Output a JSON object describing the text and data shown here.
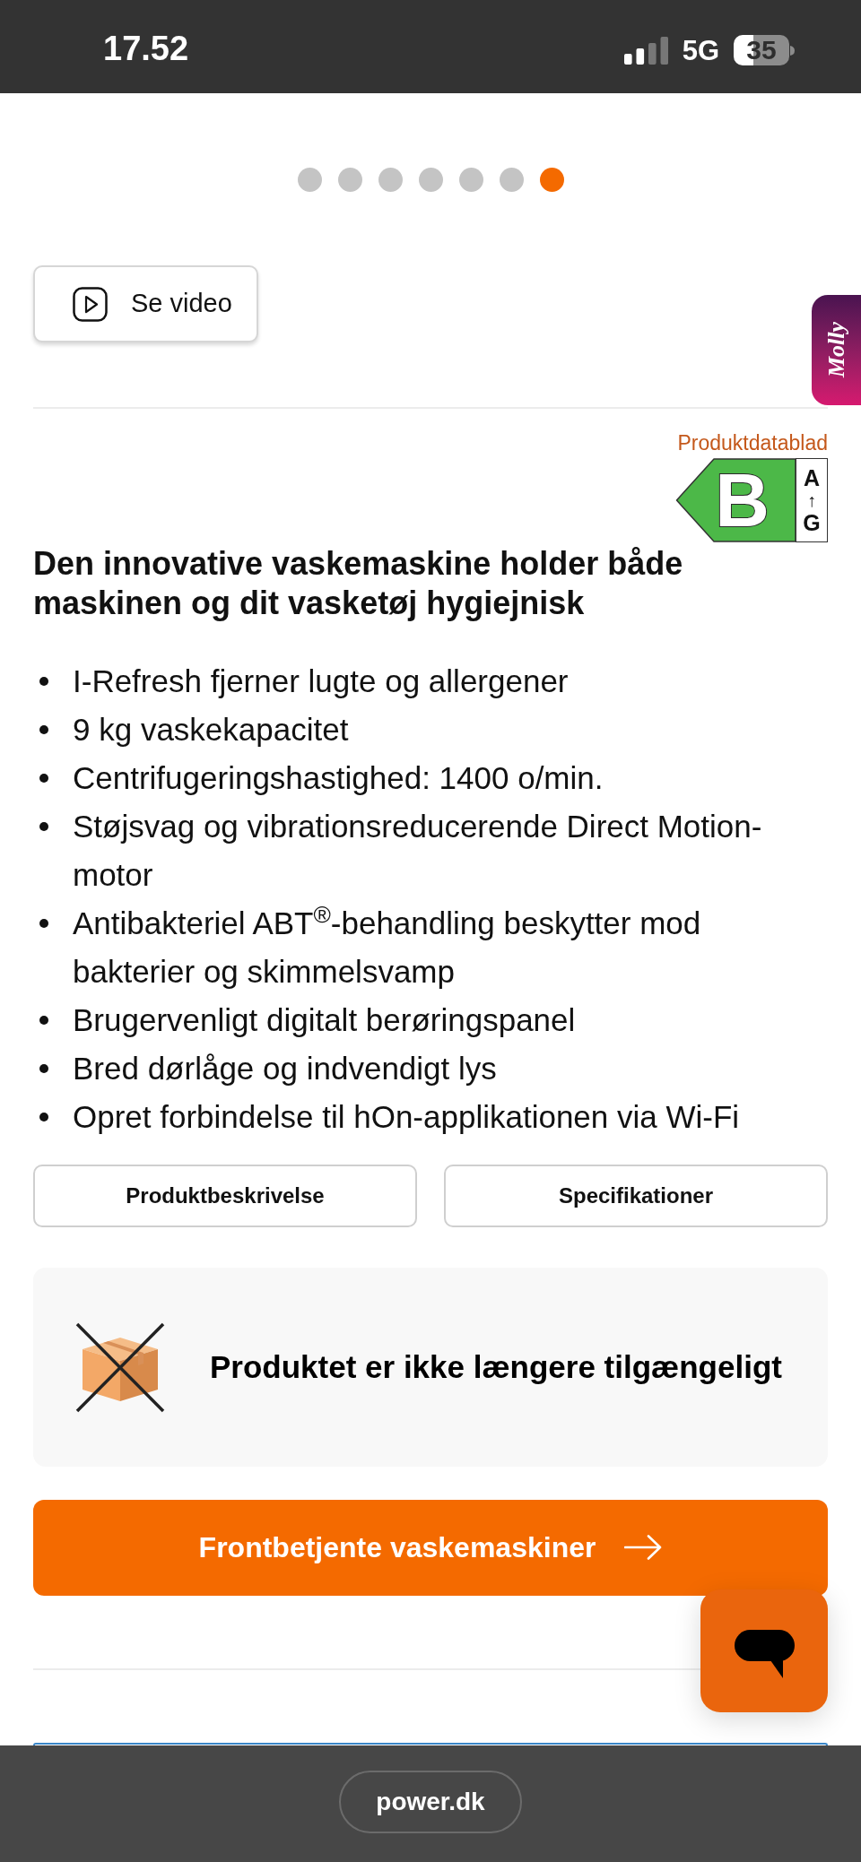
{
  "status_bar": {
    "time": "17.52",
    "network": "5G",
    "battery": "35"
  },
  "gallery": {
    "dots": [
      {
        "selected": false
      },
      {
        "selected": false
      },
      {
        "selected": false
      },
      {
        "selected": false
      },
      {
        "selected": false
      },
      {
        "selected": false
      },
      {
        "selected": true
      }
    ]
  },
  "video_button": {
    "label": "Se video"
  },
  "assistant_tab": {
    "label": "Molly"
  },
  "energy_label": {
    "link": "Produktdatablad",
    "class": "B",
    "scale_top": "A",
    "scale_arrow": "↑",
    "scale_bottom": "G"
  },
  "heading": "Den innovative vaskemaskine holder både maskinen og dit vasketøj hygiejnisk",
  "features": [
    "I-Refresh fjerner lugte og allergener",
    "9 kg vaskekapacitet",
    "Centrifugeringshastighed: 1400 o/min.",
    "Støjsvag og vibrationsreducerende Direct Motion-motor",
    "Antibakteriel ABT$^{®}$-behandling beskytter mod bakterier og skimmelsvamp",
    "Brugervenligt digitalt berøringspanel",
    "Bred dørlåge og indvendigt lys",
    "Opret forbindelse til hOn-applikationen via Wi-Fi"
  ],
  "section_buttons": [
    {
      "label": "Produktbeskrivelse"
    },
    {
      "label": "Specifikationer"
    }
  ],
  "availability": {
    "message": "Produktet er ikke længere tilgængeligt"
  },
  "category_button": {
    "label": "Frontbetjente vaskemaskiner"
  },
  "browser_bar": {
    "url": "power.dk"
  }
}
